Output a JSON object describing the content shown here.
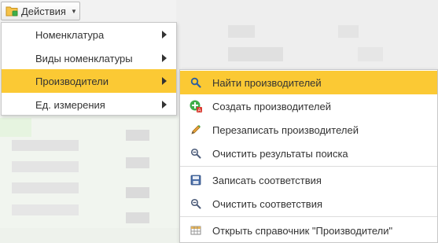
{
  "actions_button": {
    "label": "Действия",
    "icon": "folder-icon"
  },
  "left_menu": {
    "items": [
      {
        "label": "Номенклатура",
        "has_submenu": true,
        "active": false
      },
      {
        "label": "Виды номенклатуры",
        "has_submenu": true,
        "active": false
      },
      {
        "label": "Производители",
        "has_submenu": true,
        "active": true
      },
      {
        "label": "Ед. измерения",
        "has_submenu": true,
        "active": false
      }
    ]
  },
  "submenu": {
    "items": [
      {
        "label": "Найти производителей",
        "icon": "search-icon",
        "active": true
      },
      {
        "label": "Создать производителей",
        "icon": "create-icon",
        "active": false
      },
      {
        "label": "Перезаписать производителей",
        "icon": "pencil-icon",
        "active": false
      },
      {
        "label": "Очистить результаты поиска",
        "icon": "clear-search-icon",
        "active": false
      },
      {
        "label": "Записать соответствия",
        "icon": "save-icon",
        "active": false
      },
      {
        "label": "Очистить соответствия",
        "icon": "clear-search-icon",
        "active": false
      },
      {
        "label": "Открыть справочник \"Производители\"",
        "icon": "table-icon",
        "active": false
      }
    ]
  },
  "colors": {
    "highlight": "#fbc934",
    "menu_bg": "#ffffff",
    "border": "#c8c8c8"
  }
}
